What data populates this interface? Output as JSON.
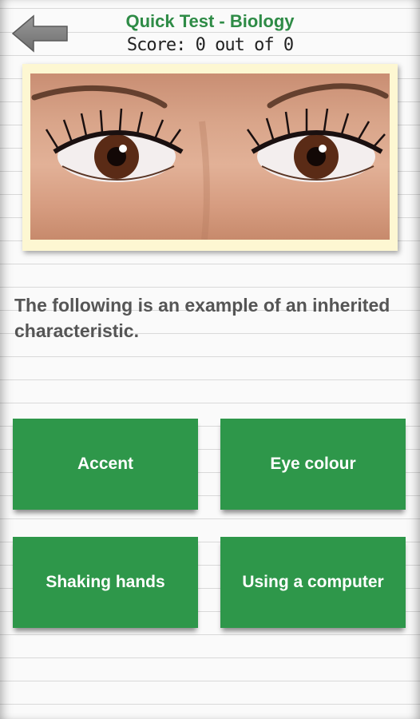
{
  "header": {
    "title": "Quick Test - Biology",
    "score_text": "Score: 0 out of 0",
    "back_icon": "left-arrow-icon"
  },
  "question": {
    "image": "close-up photo of a woman's brown eyes",
    "text": "The following is an example of an inherited characteristic."
  },
  "answers": [
    {
      "label": "Accent"
    },
    {
      "label": "Eye colour"
    },
    {
      "label": "Shaking hands"
    },
    {
      "label": "Using a computer"
    }
  ],
  "colors": {
    "title_green": "#2e8b46",
    "button_green": "#2e974a",
    "frame_cream": "#fdf7d2"
  }
}
